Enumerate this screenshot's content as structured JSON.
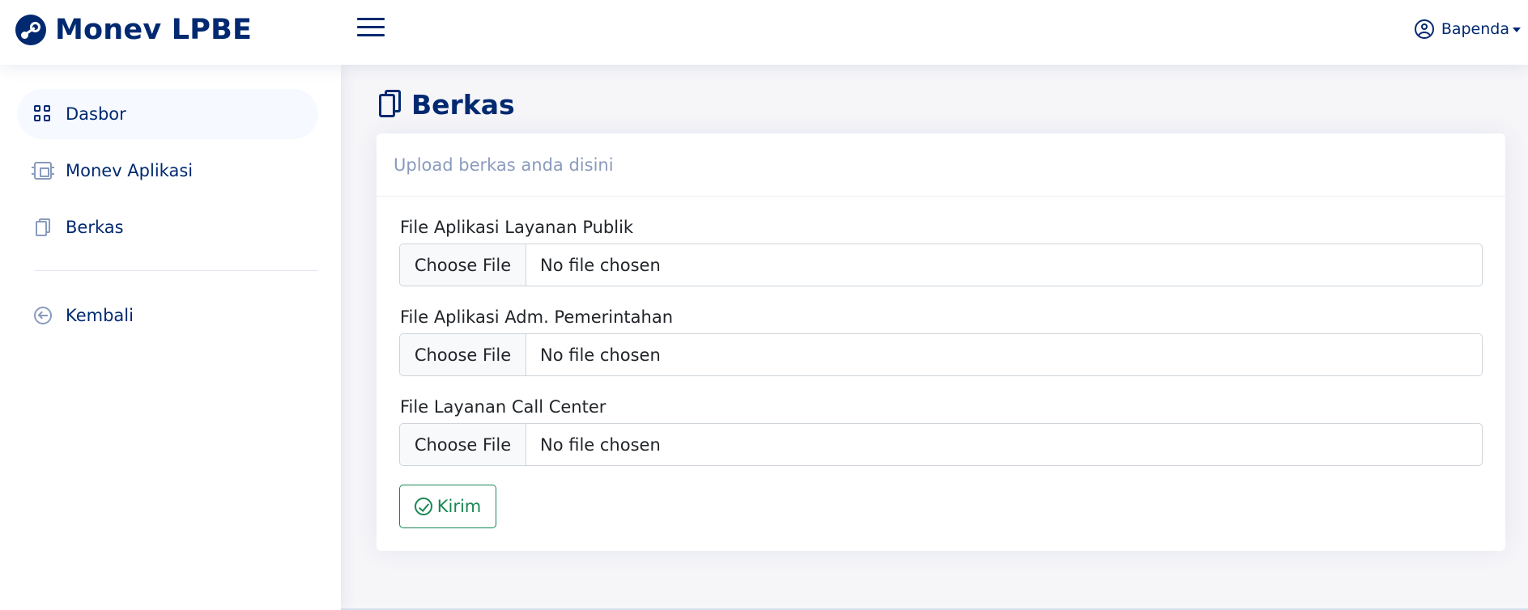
{
  "app": {
    "title": "Monev LPBE"
  },
  "user": {
    "name": "Bapenda"
  },
  "sidebar": {
    "items": [
      {
        "label": "Dasbor",
        "icon": "grid-icon",
        "active": true
      },
      {
        "label": "Monev Aplikasi",
        "icon": "cpu-icon",
        "active": false
      },
      {
        "label": "Berkas",
        "icon": "files-icon",
        "active": false
      }
    ],
    "back": {
      "label": "Kembali",
      "icon": "arrow-left-circle-icon"
    }
  },
  "page": {
    "title": "Berkas"
  },
  "card": {
    "header": "Upload berkas anda disini",
    "fields": [
      {
        "label": "File Aplikasi Layanan Publik",
        "button": "Choose File",
        "status": "No file chosen"
      },
      {
        "label": "File Aplikasi Adm. Pemerintahan",
        "button": "Choose File",
        "status": "No file chosen"
      },
      {
        "label": "File Layanan Call Center",
        "button": "Choose File",
        "status": "No file chosen"
      }
    ],
    "submit": "Kirim"
  },
  "colors": {
    "primary": "#012970",
    "muted": "#899bbd",
    "success": "#198754",
    "background": "#f6f6f9"
  }
}
